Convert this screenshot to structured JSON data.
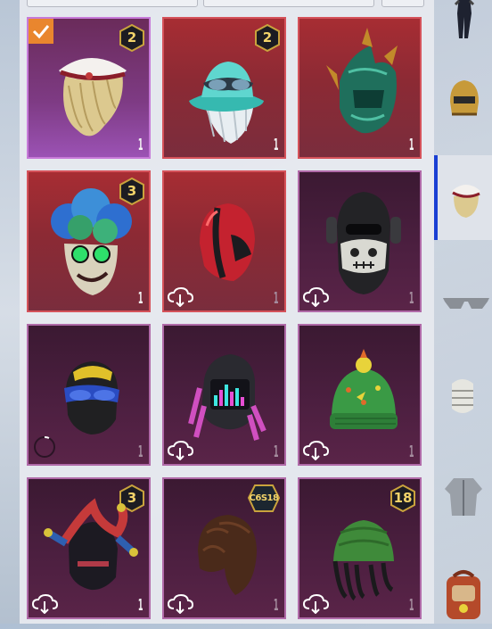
{
  "inventory": {
    "items": [
      {
        "name": "hair-white-bandana",
        "rarity": "purple-selected",
        "level_badge": "2",
        "count": "1",
        "selected": true,
        "downloadable": false
      },
      {
        "name": "teal-bucket-hat",
        "rarity": "red",
        "level_badge": "2",
        "count": "1",
        "selected": false,
        "downloadable": false
      },
      {
        "name": "green-spiked-helmet",
        "rarity": "red",
        "level_badge": "",
        "count": "1",
        "selected": false,
        "downloadable": false
      },
      {
        "name": "joker-mask",
        "rarity": "red",
        "level_badge": "3",
        "count": "1",
        "selected": false,
        "downloadable": false
      },
      {
        "name": "red-helmet",
        "rarity": "red",
        "level_badge": "",
        "count": "1",
        "selected": false,
        "downloadable": true
      },
      {
        "name": "skull-balaclava",
        "rarity": "purple",
        "level_badge": "",
        "count": "1",
        "selected": false,
        "downloadable": true
      },
      {
        "name": "goggles-mask",
        "rarity": "purple",
        "level_badge": "",
        "count": "1",
        "selected": false,
        "downloadable": false,
        "loading": true
      },
      {
        "name": "neon-robot-helmet",
        "rarity": "purple",
        "level_badge": "",
        "count": "1",
        "selected": false,
        "downloadable": true
      },
      {
        "name": "cactus-beanie",
        "rarity": "purple",
        "level_badge": "",
        "count": "1",
        "selected": false,
        "downloadable": true
      },
      {
        "name": "jester-hat",
        "rarity": "purple",
        "level_badge": "3",
        "count": "1",
        "selected": false,
        "downloadable": true
      },
      {
        "name": "brown-hair",
        "rarity": "purple",
        "level_badge": "C6S18",
        "count": "1",
        "selected": false,
        "downloadable": true
      },
      {
        "name": "green-beanie-dreads",
        "rarity": "purple",
        "level_badge": "18",
        "count": "1",
        "selected": false,
        "downloadable": true
      }
    ]
  },
  "category_rail": [
    {
      "name": "outfit",
      "active": false
    },
    {
      "name": "helmet",
      "active": false
    },
    {
      "name": "headwear",
      "active": true
    },
    {
      "name": "glasses",
      "active": false
    },
    {
      "name": "mask",
      "active": false
    },
    {
      "name": "top",
      "active": false
    },
    {
      "name": "backpack",
      "active": false
    }
  ],
  "colors": {
    "selected_check": "#e9862e",
    "badge_gold": "#f3d46a",
    "rail_active": "#1a3fd3",
    "red_tier": "#a72d33",
    "purple_tier": "#4c1f40"
  }
}
